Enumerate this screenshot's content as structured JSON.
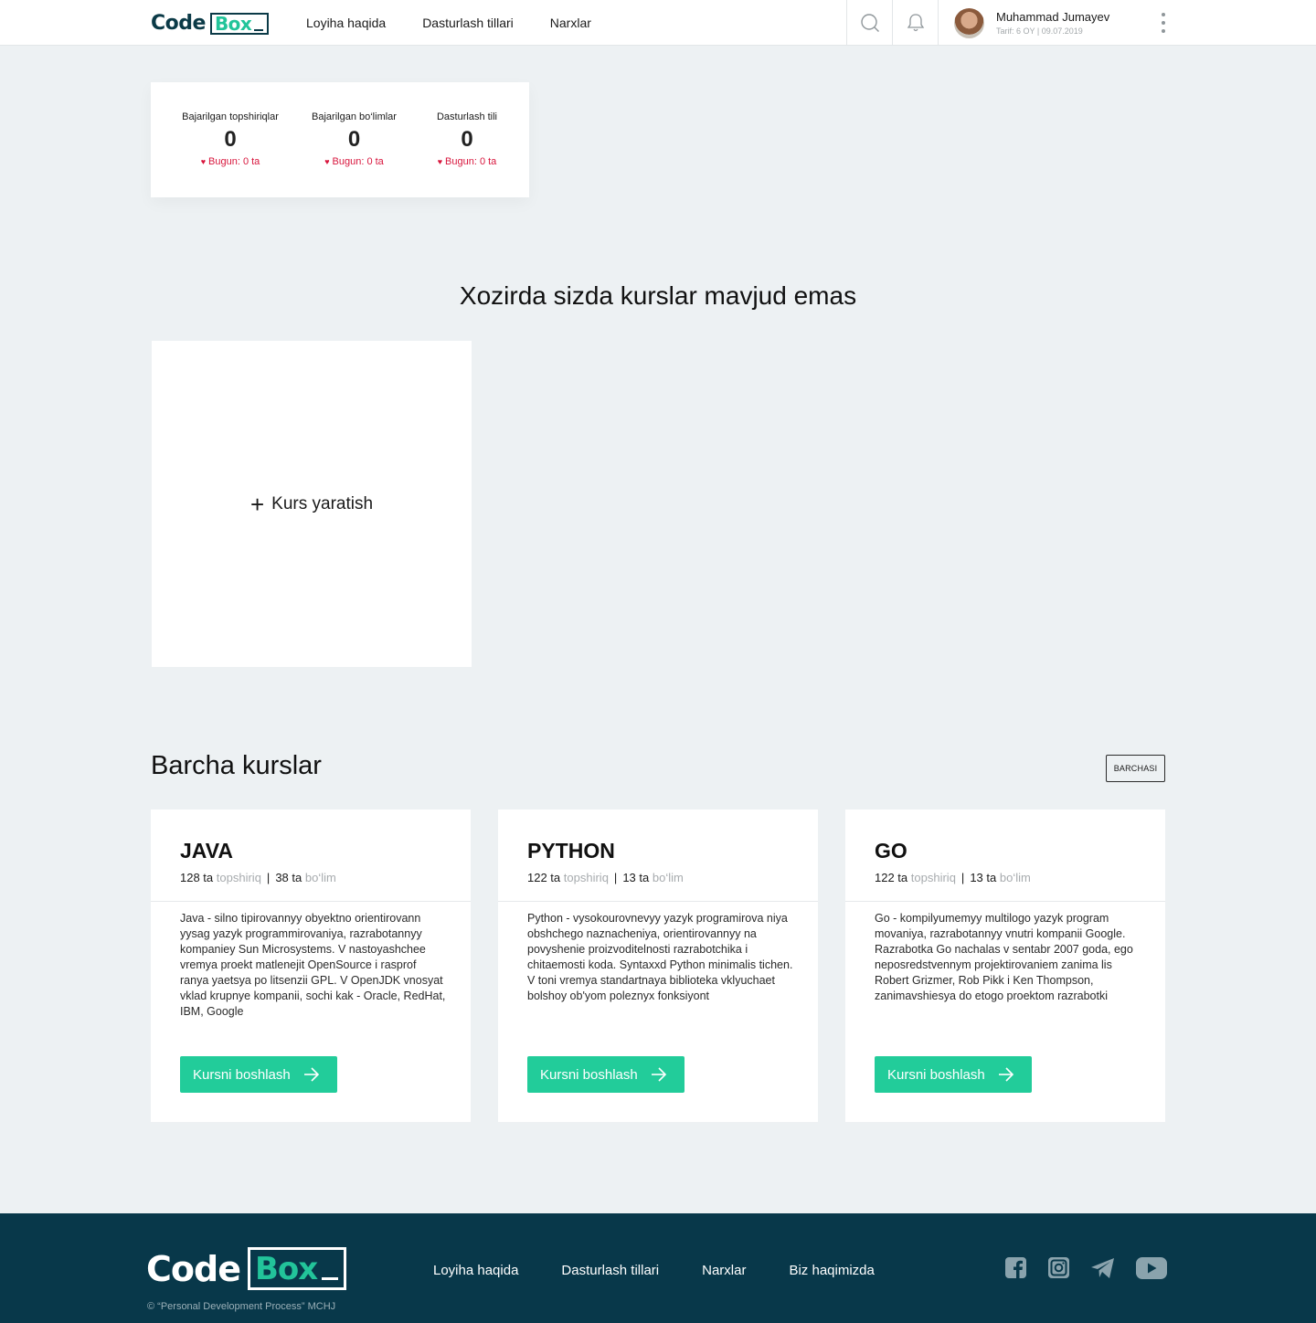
{
  "header": {
    "logo_code": "Code",
    "logo_box": "Box",
    "nav": [
      "Loyiha haqida",
      "Dasturlash tillari",
      "Narxlar"
    ],
    "user_name": "Muhammad Jumayev",
    "user_tarif": "Tarif: 6 OY | 09.07.2019"
  },
  "stats": [
    {
      "label": "Bajarilgan topshiriqlar",
      "value": "0",
      "today": "Bugun: 0 ta"
    },
    {
      "label": "Bajarilgan bo‘limlar",
      "value": "0",
      "today": "Bugun: 0 ta"
    },
    {
      "label": "Dasturlash tili",
      "value": "0",
      "today": "Bugun: 0 ta"
    }
  ],
  "empty_title": "Xozirda sizda kurslar mavjud emas",
  "create_course": "Kurs yaratish",
  "all_courses": {
    "title": "Barcha kurslar",
    "all_button": "BARCHASI"
  },
  "courses": [
    {
      "name": "JAVA",
      "tasks_count": "128 ta",
      "tasks_label": "topshiriq",
      "sections_count": "38 ta",
      "sections_label": "bo‘lim",
      "description": "Java - silno tipirovannyy obyektno orientirovann yysag yazyk programmirovaniya, razrabotannyy kompaniey Sun Microsystems. V nastoyashchee vremya proekt matlenejit OpenSource i rasprof ranya yaetsya po litsenzii GPL. V OpenJDK vnosyat vklad krupnye kompanii, sochi kak - Oracle, RedHat, IBM, Google",
      "button": "Kursni boshlash"
    },
    {
      "name": "PYTHON",
      "tasks_count": "122 ta",
      "tasks_label": "topshiriq",
      "sections_count": "13 ta",
      "sections_label": "bo‘lim",
      "description": "Python - vysokourovnevyy yazyk programirova niya obshchego naznacheniya, orientirovannyy na povyshenie proizvoditelnosti razrabotchika i chitaemosti koda. Syntaxxd Python minimalis tichen. V toni vremya standartnaya biblioteka vklyuchaet bolshoy ob'yom poleznyx fonksiyont",
      "button": "Kursni boshlash"
    },
    {
      "name": "GO",
      "tasks_count": "122 ta",
      "tasks_label": "topshiriq",
      "sections_count": "13 ta",
      "sections_label": "bo‘lim",
      "description": "Go - kompilyumemyy multilogo yazyk program movaniya, razrabotannyy vnutri kompanii Google. Razrabotka Go nachalas v sentabr 2007 goda, ego neposredstvennym projektirovaniem zanima lis Robert Grizmer, Rob Pikk i Ken Thompson, zanimavshiesya do etogo proektom razrabotki",
      "button": "Kursni boshlash"
    }
  ],
  "footer": {
    "logo_code": "Code",
    "logo_box": "Box",
    "copyright": "© “Personal Development Process” MCHJ",
    "nav": [
      "Loyiha haqida",
      "Dasturlash tillari",
      "Narxlar",
      "Biz haqimizda"
    ],
    "social": [
      "facebook-icon",
      "instagram-icon",
      "telegram-icon",
      "youtube-icon"
    ]
  },
  "colors": {
    "brand_dark": "#0b3a47",
    "brand_green": "#22cc9a",
    "alert_red": "#d8163d",
    "footer_bg": "#08384a",
    "page_bg": "#edf1f3"
  }
}
